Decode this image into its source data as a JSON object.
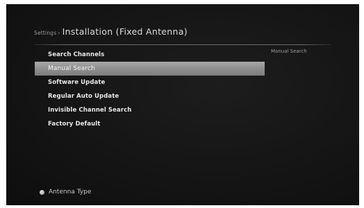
{
  "header": {
    "breadcrumb": "Settings",
    "separator": "›",
    "title": "Installation (Fixed Antenna)"
  },
  "menu": {
    "items": [
      {
        "label": "Search Channels",
        "selected": false
      },
      {
        "label": "Manual Search",
        "selected": true
      },
      {
        "label": "Software Update",
        "selected": false
      },
      {
        "label": "Regular Auto Update",
        "selected": false
      },
      {
        "label": "Invisible Channel Search",
        "selected": false
      },
      {
        "label": "Factory Default",
        "selected": false
      }
    ]
  },
  "help": {
    "text": "Manual Search"
  },
  "footer": {
    "button_label": "Antenna Type",
    "button_icon": "circle-button-icon"
  },
  "colors": {
    "background": "#151515",
    "highlight": "#959595",
    "text": "#e8e8e8"
  }
}
